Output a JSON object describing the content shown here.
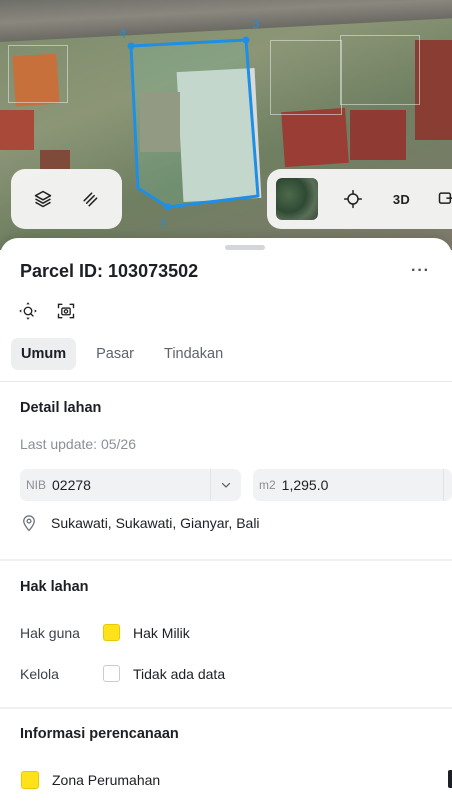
{
  "map": {
    "vertex_labels": [
      "3",
      "4",
      "1"
    ],
    "controls_left": [
      {
        "icon": "layers-icon"
      },
      {
        "icon": "measure-icon"
      }
    ],
    "controls_right": {
      "thumbnail_icon": "satellite-thumbnail",
      "locate_icon": "crosshair-icon",
      "mode_3d_label": "3D",
      "share_icon": "share-icon"
    },
    "polygon_color": "#1e8fe6"
  },
  "sheet": {
    "title": "Parcel ID: 103073502",
    "more_label": "···",
    "tools": [
      {
        "icon": "zoom-to-parcel-icon"
      },
      {
        "icon": "screenshot-icon"
      }
    ],
    "tabs": [
      {
        "label": "Umum",
        "active": true
      },
      {
        "label": "Pasar",
        "active": false
      },
      {
        "label": "Tindakan",
        "active": false
      }
    ]
  },
  "detail": {
    "title": "Detail lahan",
    "last_update": "Last update: 05/26",
    "nib_label": "NIB",
    "nib_value": "02278",
    "area_label": "m2",
    "area_value": "1,295.0",
    "location_icon": "location-pin-icon",
    "location": "Sukawati, Sukawati, Gianyar, Bali"
  },
  "hak": {
    "title": "Hak lahan",
    "rows": [
      {
        "key": "Hak guna",
        "value": "Hak Milik",
        "swatch": "#ffe21a"
      },
      {
        "key": "Kelola",
        "value": "Tidak ada data",
        "swatch": "#ffffff"
      }
    ]
  },
  "planning": {
    "title": "Informasi perencanaan",
    "zona_label": "Zona Perumahan",
    "zona_color": "#ffe21a"
  }
}
